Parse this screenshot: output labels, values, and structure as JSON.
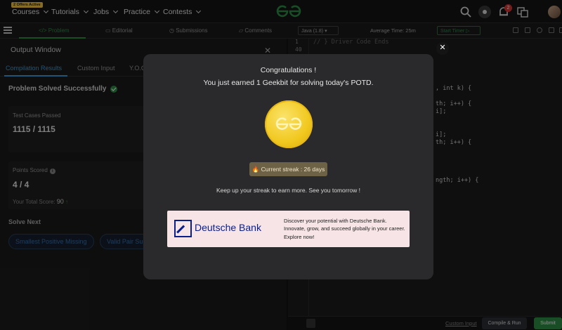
{
  "topnav": {
    "offer_badge": "2 Offers Active",
    "items": [
      "Courses",
      "Tutorials",
      "Jobs",
      "Practice",
      "Contests"
    ],
    "notification_count": "2"
  },
  "problem_tabs": [
    "Problem",
    "Editorial",
    "Submissions",
    "Comments"
  ],
  "editor": {
    "language": "Java (1.8)",
    "average_time": "Average Time: 25m",
    "start_timer": "Start Timer",
    "line_numbers": [
      "1",
      "40"
    ],
    "code_comment": "// } Driver Code Ends",
    "code_fragments": [
      ", int k) {",
      "th; i++) {",
      "i];",
      "i];",
      "th; i++) {",
      "ngth; i++) {"
    ]
  },
  "output_window": {
    "title": "Output Window",
    "tabs": [
      "Compilation Results",
      "Custom Input",
      "Y.O.G"
    ],
    "status": "Problem Solved Successfully",
    "test_cases_label": "Test Cases Passed",
    "test_cases_value": "1115 / 1115",
    "points_label": "Points Scored",
    "points_value": "4 / 4",
    "total_score_label": "Your Total Score:",
    "total_score_value": "90",
    "solve_next_label": "Solve Next",
    "solve_next": [
      "Smallest Positive Missing",
      "Valid Pair Sum"
    ]
  },
  "bottom": {
    "custom_input": "Custom Input",
    "compile_run": "Compile & Run",
    "submit": "Submit"
  },
  "modal": {
    "title": "Congratulations !",
    "message": "You just earned 1 Geekbit for solving today's POTD.",
    "streak": "🔥 Current streak : 26 days",
    "keep_up": "Keep up your streak to earn more. See you tomorrow !",
    "ad_brand": "Deutsche Bank",
    "ad_text": "Discover your potential with Deutsche Bank. Innovate, grow, and succeed globally in your career. Explore now!"
  },
  "colors": {
    "brand_green": "#2f8d46",
    "link_blue": "#3a9bdc",
    "coin_gold": "#f1c81e",
    "db_blue": "#0a1e8c"
  }
}
